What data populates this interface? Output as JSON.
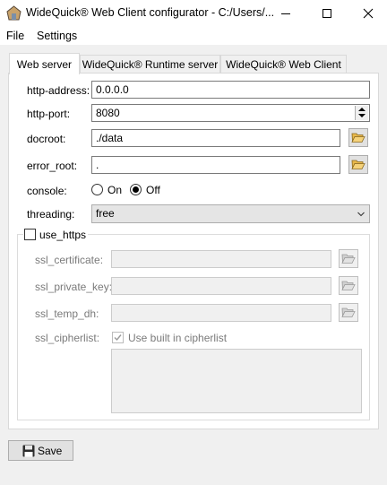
{
  "window": {
    "title": "WideQuick® Web Client configurator - C:/Users/...",
    "controls": {
      "minimize": "minimize-icon",
      "maximize": "maximize-icon",
      "close": "close-icon"
    }
  },
  "menu": {
    "file": "File",
    "settings": "Settings"
  },
  "tabs": [
    {
      "label": "Web server",
      "active": true
    },
    {
      "label": "WideQuick® Runtime server",
      "active": false
    },
    {
      "label": "WideQuick® Web Client",
      "active": false
    }
  ],
  "form": {
    "http_address": {
      "label": "http-address:",
      "value": "0.0.0.0"
    },
    "http_port": {
      "label": "http-port:",
      "value": "8080"
    },
    "docroot": {
      "label": "docroot:",
      "value": "./data"
    },
    "error_root": {
      "label": "error_root:",
      "value": "."
    },
    "console": {
      "label": "console:",
      "options": [
        "On",
        "Off"
      ],
      "selected": "Off"
    },
    "threading": {
      "label": "threading:",
      "value": "free"
    }
  },
  "https": {
    "label": "use_https",
    "checked": false,
    "ssl_certificate": {
      "label": "ssl_certificate:",
      "value": ""
    },
    "ssl_private_key": {
      "label": "ssl_private_key:",
      "value": ""
    },
    "ssl_temp_dh": {
      "label": "ssl_temp_dh:",
      "value": ""
    },
    "ssl_cipherlist": {
      "label": "ssl_cipherlist:",
      "checkbox_label": "Use built in cipherlist",
      "checked": true,
      "value": ""
    }
  },
  "footer": {
    "save_label": "Save",
    "save_icon": "floppy-disk-icon"
  },
  "colors": {
    "accent": "#000000",
    "panel_bg": "#ffffff",
    "window_bg": "#f0f0f0",
    "folder_yellow": "#e8b84a"
  }
}
